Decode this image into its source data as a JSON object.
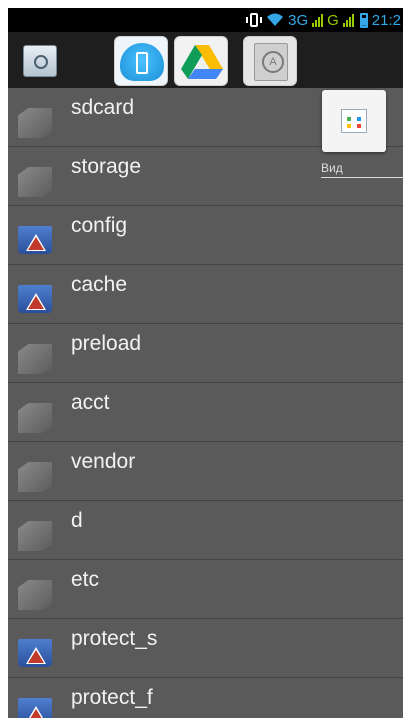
{
  "status_bar": {
    "network_label": "3G",
    "mobile_label": "G",
    "time": "21:2",
    "icons": [
      "vibrate-icon",
      "wifi-icon",
      "signal-icon",
      "battery-icon"
    ]
  },
  "toolbar": {
    "tabs": [
      {
        "name": "settings",
        "icon": "settings-icon"
      },
      {
        "name": "device",
        "icon": "phone-cloud-icon"
      },
      {
        "name": "drive",
        "icon": "google-drive-icon"
      },
      {
        "name": "apps",
        "icon": "app-store-icon"
      }
    ]
  },
  "view_menu": {
    "label": "Вид",
    "icon": "grid-view-icon"
  },
  "files": [
    {
      "name": "sdcard",
      "type": "folder"
    },
    {
      "name": "storage",
      "type": "folder"
    },
    {
      "name": "config",
      "type": "restricted"
    },
    {
      "name": "cache",
      "type": "restricted"
    },
    {
      "name": "preload",
      "type": "folder"
    },
    {
      "name": "acct",
      "type": "folder"
    },
    {
      "name": "vendor",
      "type": "folder"
    },
    {
      "name": "d",
      "type": "folder"
    },
    {
      "name": "etc",
      "type": "folder"
    },
    {
      "name": "protect_s",
      "type": "restricted"
    },
    {
      "name": "protect_f",
      "type": "restricted"
    }
  ],
  "colors": {
    "list_bg": "#5a5a5a",
    "status_accent": "#35a7e6",
    "signal_green": "#99cc00"
  }
}
